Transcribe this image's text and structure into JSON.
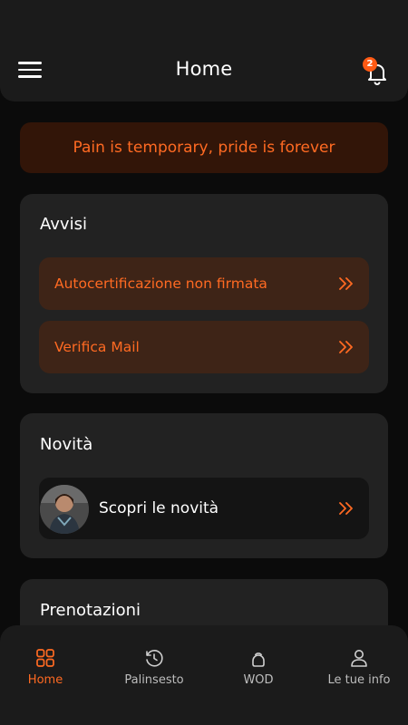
{
  "header": {
    "title": "Home",
    "notification_count": "2"
  },
  "motto": "Pain is temporary, pride is forever",
  "avvisi": {
    "title": "Avvisi",
    "items": [
      {
        "label": "Autocertificazione non firmata"
      },
      {
        "label": "Verifica Mail"
      }
    ]
  },
  "novita": {
    "title": "Novità",
    "item_label": "Scopri le novità"
  },
  "prenotazioni": {
    "title": "Prenotazioni"
  },
  "bottom_nav": {
    "items": [
      {
        "label": "Home",
        "icon": "grid-icon",
        "active": true
      },
      {
        "label": "Palinsesto",
        "icon": "schedule-icon",
        "active": false
      },
      {
        "label": "WOD",
        "icon": "kettlebell-icon",
        "active": false
      },
      {
        "label": "Le tue info",
        "icon": "user-icon",
        "active": false
      }
    ]
  },
  "colors": {
    "accent": "#ff6a22",
    "background": "#0b0b0b",
    "card": "#222222",
    "alert_bg": "#3e2417"
  }
}
